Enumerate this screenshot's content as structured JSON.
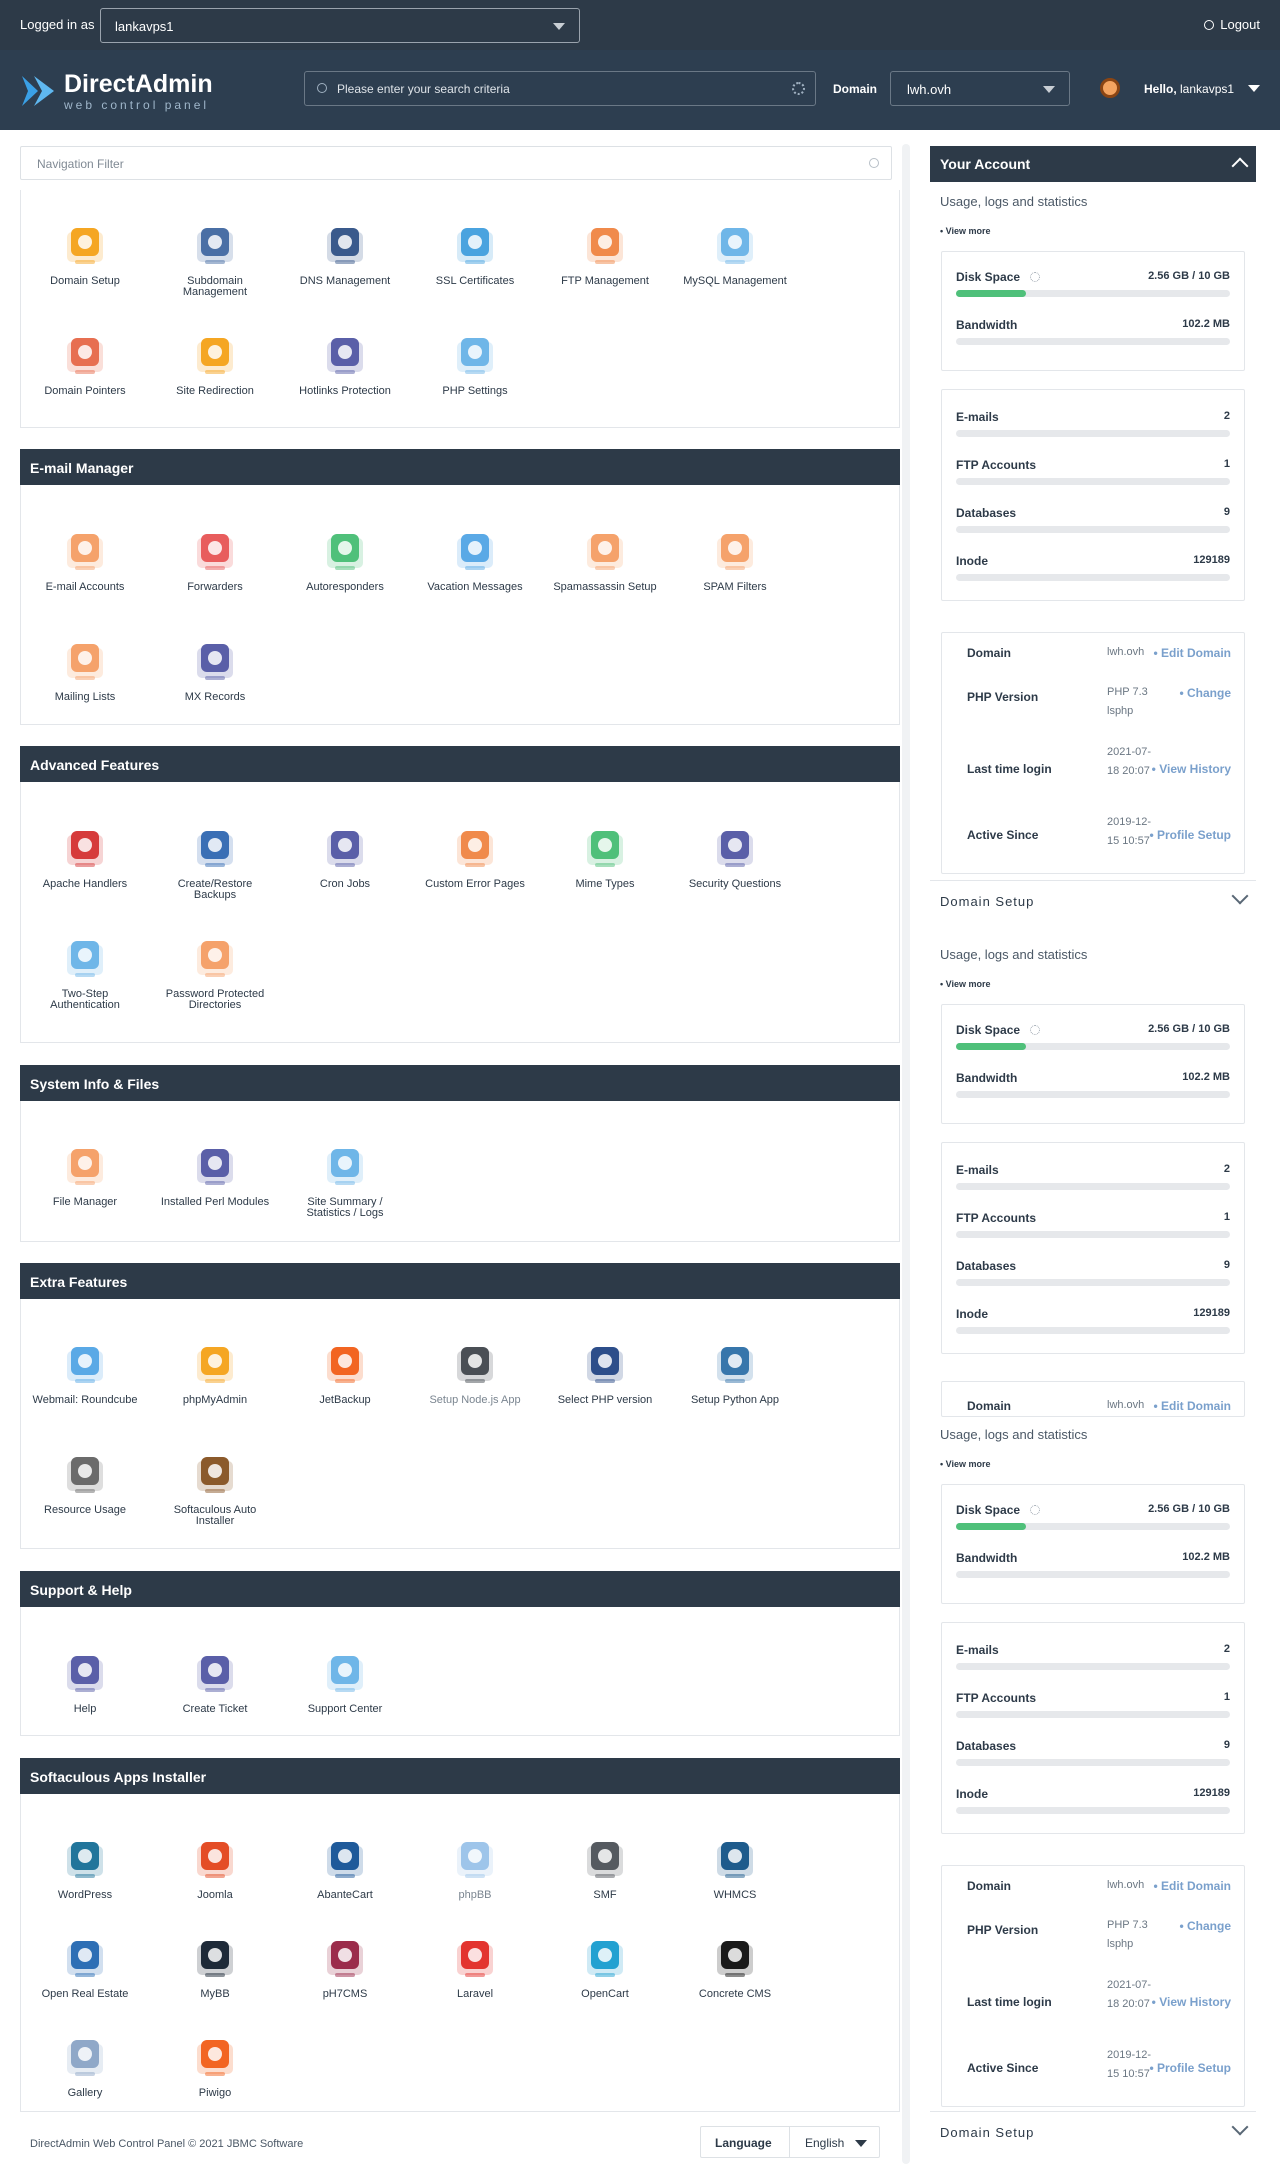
{
  "topbar": {
    "logged_in_label": "Logged in as",
    "user": "lankavps1",
    "logout": "Logout"
  },
  "header": {
    "logo_title": "DirectAdmin",
    "logo_sub": "web control panel",
    "search_placeholder": "Please enter your search criteria",
    "domain_label": "Domain",
    "domain_value": "lwh.ovh",
    "hello_label": "Hello,",
    "hello_user": "lankavps1"
  },
  "nav_filter": {
    "placeholder": "Navigation Filter"
  },
  "sections": [
    {
      "title": "",
      "tiles": [
        {
          "label": "Domain Setup",
          "icon": "www-globe-icon",
          "color": "#f5a623"
        },
        {
          "label": "Subdomain Management",
          "icon": "subdomain-icon",
          "color": "#4a6fa5"
        },
        {
          "label": "DNS Management",
          "icon": "dns-icon",
          "color": "#3a5a8c"
        },
        {
          "label": "SSL Certificates",
          "icon": "ssl-badge-icon",
          "color": "#4aa3df"
        },
        {
          "label": "FTP Management",
          "icon": "ftp-icon",
          "color": "#f08a4b"
        },
        {
          "label": "MySQL Management",
          "icon": "sql-icon",
          "color": "#6fb6e8"
        },
        {
          "label": "Domain Pointers",
          "icon": "domain-pointer-icon",
          "color": "#e76f51"
        },
        {
          "label": "Site Redirection",
          "icon": "signpost-icon",
          "color": "#f5a623"
        },
        {
          "label": "Hotlinks Protection",
          "icon": "lock-icon",
          "color": "#5a5fa8"
        },
        {
          "label": "PHP Settings",
          "icon": "php-settings-icon",
          "color": "#6fb6e8"
        }
      ]
    },
    {
      "title": "E-mail Manager",
      "tiles": [
        {
          "label": "E-mail Accounts",
          "icon": "mail-accounts-icon",
          "color": "#f5a26b"
        },
        {
          "label": "Forwarders",
          "icon": "forward-mail-icon",
          "color": "#e85d5d"
        },
        {
          "label": "Autoresponders",
          "icon": "autoresponder-icon",
          "color": "#4fc07a"
        },
        {
          "label": "Vacation Messages",
          "icon": "vacation-icon",
          "color": "#5aa9e6"
        },
        {
          "label": "Spamassassin Setup",
          "icon": "spamassassin-icon",
          "color": "#f5a26b"
        },
        {
          "label": "SPAM Filters",
          "icon": "spam-filter-icon",
          "color": "#f5a26b"
        },
        {
          "label": "Mailing Lists",
          "icon": "mailing-list-icon",
          "color": "#f5a26b"
        },
        {
          "label": "MX Records",
          "icon": "mx-records-icon",
          "color": "#5a5fa8"
        }
      ]
    },
    {
      "title": "Advanced Features",
      "tiles": [
        {
          "label": "Apache Handlers",
          "icon": "apache-feather-icon",
          "color": "#d63b3b"
        },
        {
          "label": "Create/Restore Backups",
          "icon": "backup-icon",
          "color": "#3a6fb5"
        },
        {
          "label": "Cron Jobs",
          "icon": "cron-robot-icon",
          "color": "#5a5fa8"
        },
        {
          "label": "Custom Error Pages",
          "icon": "error-page-icon",
          "color": "#f08a4b"
        },
        {
          "label": "Mime Types",
          "icon": "mime-types-icon",
          "color": "#4fc07a"
        },
        {
          "label": "Security Questions",
          "icon": "security-lock-icon",
          "color": "#5a5fa8"
        },
        {
          "label": "Two-Step Authentication",
          "icon": "two-step-icon",
          "color": "#6fb6e8"
        },
        {
          "label": "Password Protected Directories",
          "icon": "protected-folder-icon",
          "color": "#f5a26b"
        }
      ]
    },
    {
      "title": "System Info & Files",
      "tiles": [
        {
          "label": "File Manager",
          "icon": "file-manager-icon",
          "color": "#f5a26b"
        },
        {
          "label": "Installed Perl Modules",
          "icon": "perl-onion-icon",
          "color": "#5a5fa8"
        },
        {
          "label": "Site Summary / Statistics / Logs",
          "icon": "statistics-icon",
          "color": "#6fb6e8"
        }
      ]
    },
    {
      "title": "Extra Features",
      "tiles": [
        {
          "label": "Webmail: Roundcube",
          "icon": "roundcube-icon",
          "color": "#5aa9e6"
        },
        {
          "label": "phpMyAdmin",
          "icon": "phpmyadmin-icon",
          "color": "#f5a623"
        },
        {
          "label": "JetBackup",
          "icon": "jetbackup-icon",
          "color": "#f26522"
        },
        {
          "label": "Setup Node.js App",
          "icon": "nodejs-icon",
          "color": "#4a4f55"
        },
        {
          "label": "Select PHP version",
          "icon": "php-version-icon",
          "color": "#2d4e8a"
        },
        {
          "label": "Setup Python App",
          "icon": "python-icon",
          "color": "#3776ab"
        },
        {
          "label": "Resource Usage",
          "icon": "gauge-icon",
          "color": "#6b6b6b"
        },
        {
          "label": "Softaculous Auto Installer",
          "icon": "softaculous-icon",
          "color": "#8b5a2b"
        }
      ]
    },
    {
      "title": "Support & Help",
      "tiles": [
        {
          "label": "Help",
          "icon": "help-icon",
          "color": "#5a5fa8"
        },
        {
          "label": "Create Ticket",
          "icon": "ticket-icon",
          "color": "#5a5fa8"
        },
        {
          "label": "Support Center",
          "icon": "support-center-icon",
          "color": "#6fb6e8"
        }
      ]
    },
    {
      "title": "Softaculous Apps Installer",
      "tiles": [
        {
          "label": "WordPress",
          "icon": "wordpress-icon",
          "color": "#21759b"
        },
        {
          "label": "Joomla",
          "icon": "joomla-icon",
          "color": "#e44d26"
        },
        {
          "label": "AbanteCart",
          "icon": "abantecart-icon",
          "color": "#1f5a9a"
        },
        {
          "label": "phpBB",
          "icon": "phpbb-icon",
          "color": "#9ec5ea"
        },
        {
          "label": "SMF",
          "icon": "smf-icon",
          "color": "#555a60"
        },
        {
          "label": "WHMCS",
          "icon": "whmcs-icon",
          "color": "#1e5b8c"
        },
        {
          "label": "Open Real Estate",
          "icon": "real-estate-icon",
          "color": "#2e6fb5"
        },
        {
          "label": "MyBB",
          "icon": "mybb-icon",
          "color": "#1e2a38"
        },
        {
          "label": "pH7CMS",
          "icon": "ph7cms-icon",
          "color": "#9b2c4b"
        },
        {
          "label": "Laravel",
          "icon": "laravel-icon",
          "color": "#e3342f"
        },
        {
          "label": "OpenCart",
          "icon": "opencart-icon",
          "color": "#23a1d1"
        },
        {
          "label": "Concrete CMS",
          "icon": "concrete-icon",
          "color": "#1a1a1a"
        },
        {
          "label": "Gallery",
          "icon": "gallery-icon",
          "color": "#8fa8c8"
        },
        {
          "label": "Piwigo",
          "icon": "piwigo-icon",
          "color": "#f26522"
        }
      ]
    }
  ],
  "account": {
    "title": "Your Account",
    "usage_label": "Usage, logs and statistics",
    "view_more": "• View more",
    "disk_label": "Disk Space",
    "disk_value": "2.56 GB / 10 GB",
    "disk_fraction": 0.256,
    "bw_label": "Bandwidth",
    "bw_value": "102.2 MB",
    "emails_label": "E-mails",
    "emails_value": "2",
    "ftp_label": "FTP Accounts",
    "ftp_value": "1",
    "db_label": "Databases",
    "db_value": "9",
    "inode_label": "Inode",
    "inode_value": "129189",
    "domain_label": "Domain",
    "domain_value": "lwh.ovh",
    "domain_link": "• Edit Domain",
    "php_label": "PHP Version",
    "php_value": "PHP 7.3 lsphp",
    "php_link": "• Change",
    "login_label": "Last time login",
    "login_value": "2021-07-18 20:07",
    "login_link": "• View History",
    "active_label": "Active Since",
    "active_value": "2019-12-15 10:57",
    "active_link": "• Profile Setup",
    "domain_setup": "Domain Setup"
  },
  "footer": {
    "copyright": "DirectAdmin Web Control Panel © 2021 JBMC Software",
    "language_label": "Language",
    "language_value": "English"
  }
}
